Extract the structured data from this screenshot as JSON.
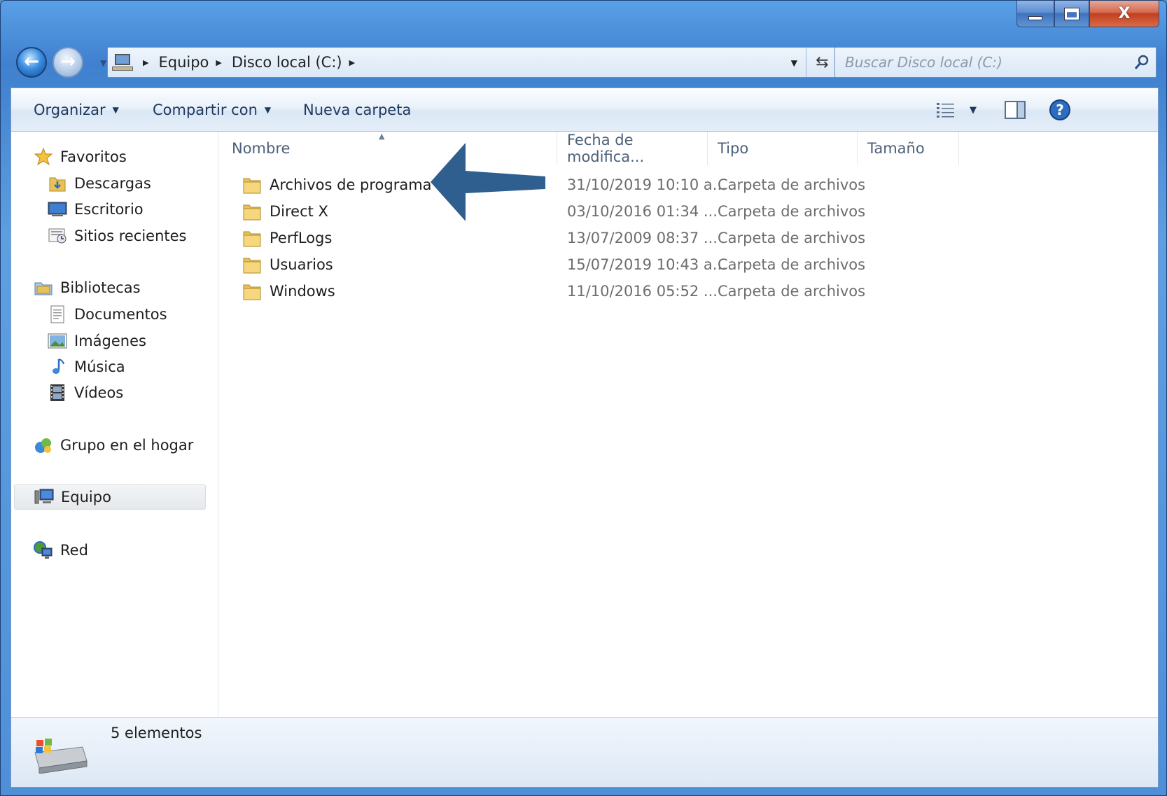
{
  "window": {
    "caption": {
      "close_glyph": "X"
    }
  },
  "nav": {
    "breadcrumbs": [
      "Equipo",
      "Disco local (C:)"
    ],
    "search_placeholder": "Buscar Disco local (C:)"
  },
  "toolbar": {
    "organize": "Organizar",
    "share": "Compartir con",
    "new_folder": "Nueva carpeta"
  },
  "navpane": {
    "favorites": {
      "label": "Favoritos",
      "items": [
        "Descargas",
        "Escritorio",
        "Sitios recientes"
      ]
    },
    "libraries": {
      "label": "Bibliotecas",
      "items": [
        "Documentos",
        "Imágenes",
        "Música",
        "Vídeos"
      ]
    },
    "homegroup": "Grupo en el hogar",
    "computer": "Equipo",
    "network": "Red"
  },
  "filelist": {
    "columns": [
      "Nombre",
      "Fecha de modifica...",
      "Tipo",
      "Tamaño"
    ],
    "rows": [
      {
        "name": "Archivos de programa",
        "date": "31/10/2019 10:10 a...",
        "type": "Carpeta de archivos"
      },
      {
        "name": "Direct X",
        "date": "03/10/2016 01:34 ...",
        "type": "Carpeta de archivos"
      },
      {
        "name": "PerfLogs",
        "date": "13/07/2009 08:37 ...",
        "type": "Carpeta de archivos"
      },
      {
        "name": "Usuarios",
        "date": "15/07/2019 10:43 a...",
        "type": "Carpeta de archivos"
      },
      {
        "name": "Windows",
        "date": "11/10/2016 05:52 ...",
        "type": "Carpeta de archivos"
      }
    ]
  },
  "status": {
    "count": "5 elementos"
  },
  "colors": {
    "accent": "#3f80cf",
    "annotation_arrow": "#2f5f8f",
    "folder": "#e8c15a"
  }
}
